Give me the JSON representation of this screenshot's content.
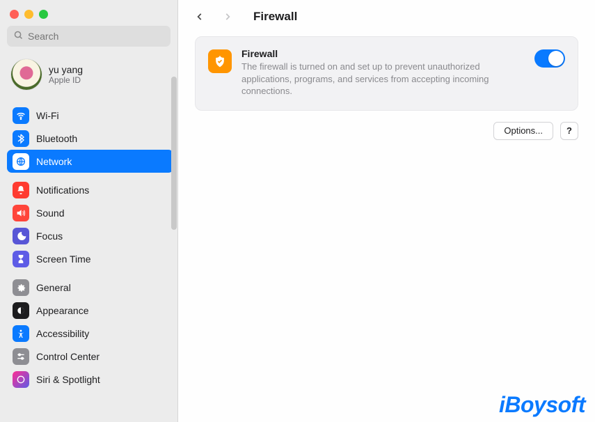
{
  "window": {
    "search_placeholder": "Search"
  },
  "account": {
    "name": "yu yang",
    "subtitle": "Apple ID"
  },
  "sidebar": {
    "group1": [
      {
        "id": "wifi",
        "label": "Wi-Fi"
      },
      {
        "id": "bluetooth",
        "label": "Bluetooth"
      },
      {
        "id": "network",
        "label": "Network"
      }
    ],
    "group2": [
      {
        "id": "notifications",
        "label": "Notifications"
      },
      {
        "id": "sound",
        "label": "Sound"
      },
      {
        "id": "focus",
        "label": "Focus"
      },
      {
        "id": "screentime",
        "label": "Screen Time"
      }
    ],
    "group3": [
      {
        "id": "general",
        "label": "General"
      },
      {
        "id": "appearance",
        "label": "Appearance"
      },
      {
        "id": "accessibility",
        "label": "Accessibility"
      },
      {
        "id": "controlcenter",
        "label": "Control Center"
      },
      {
        "id": "siri",
        "label": "Siri & Spotlight"
      }
    ],
    "selected": "network"
  },
  "header": {
    "title": "Firewall"
  },
  "firewall": {
    "title": "Firewall",
    "description": "The firewall is turned on and set up to prevent unauthorized applications, programs, and services from accepting incoming connections.",
    "enabled": true
  },
  "buttons": {
    "options": "Options...",
    "help": "?"
  },
  "watermark": "iBoysoft",
  "colors": {
    "accent": "#0a7aff",
    "orange": "#ff9500"
  }
}
